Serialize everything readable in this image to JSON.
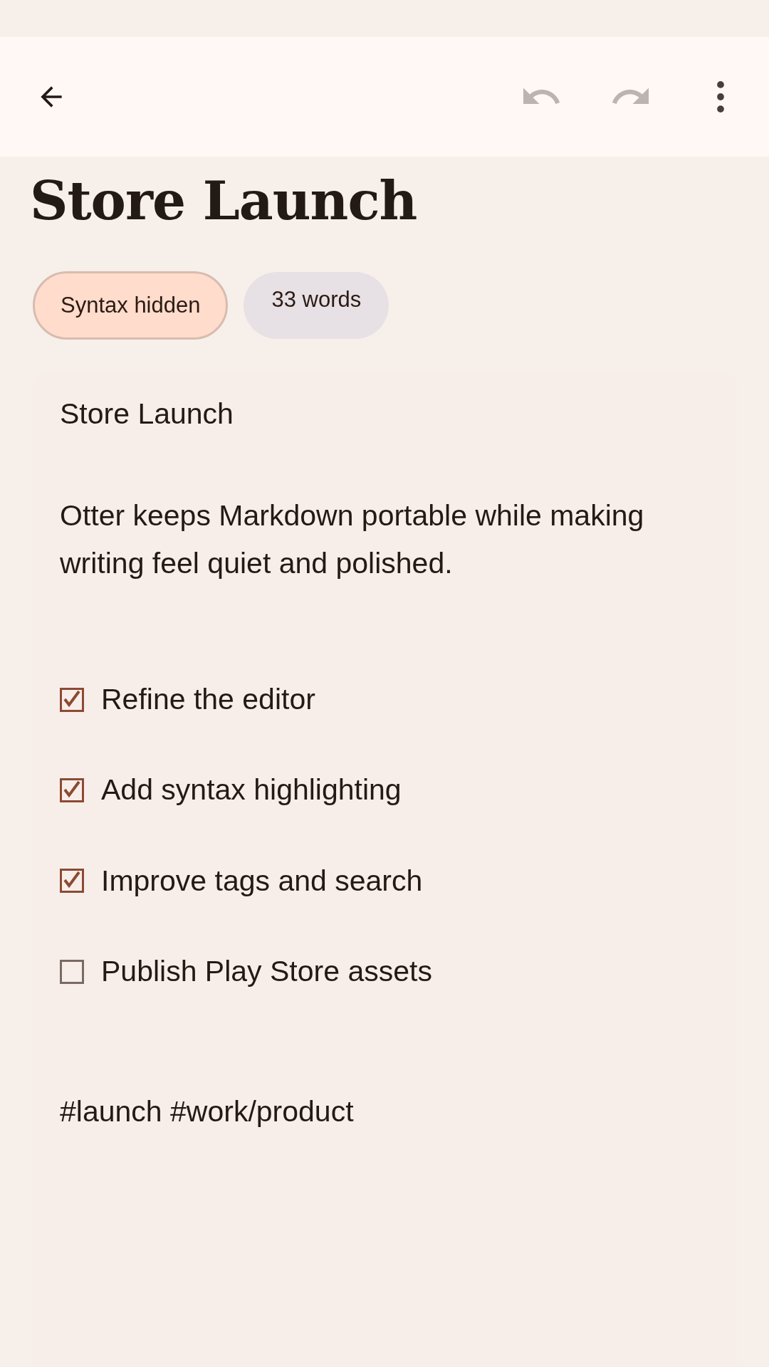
{
  "toolbar": {
    "actions": [
      {
        "kind": "undo",
        "disabled": true
      },
      {
        "kind": "redo",
        "disabled": true
      },
      {
        "kind": "more",
        "disabled": false
      }
    ]
  },
  "title": "Store Launch",
  "chips": [
    {
      "label": "Syntax hidden",
      "selected": true
    },
    {
      "label": "33 words",
      "selected": false
    }
  ],
  "editor": {
    "heading": "Store Launch",
    "paragraph": "Otter keeps Markdown portable while making writing feel quiet and polished.",
    "tasks": [
      {
        "label": "Refine the editor",
        "checked": true
      },
      {
        "label": "Add syntax highlighting",
        "checked": true
      },
      {
        "label": "Improve tags and search",
        "checked": true
      },
      {
        "label": "Publish Play Store assets",
        "checked": false
      }
    ],
    "tags": "#launch #work/product"
  }
}
